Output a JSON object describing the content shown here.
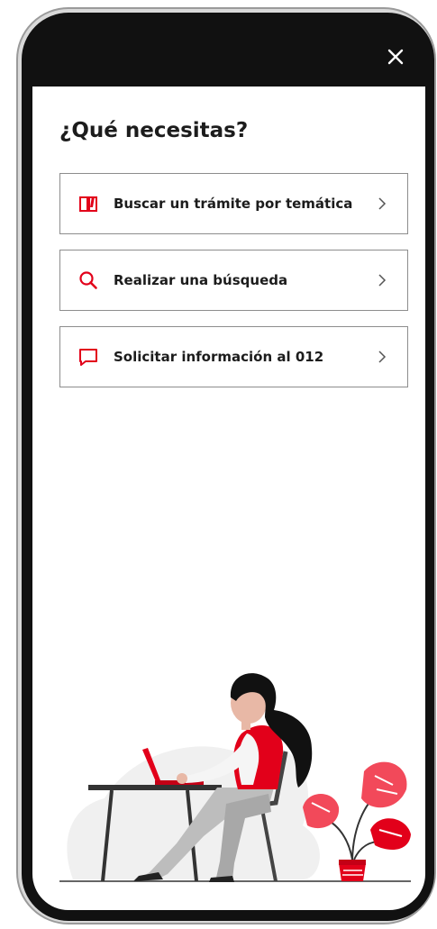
{
  "header": {
    "close_icon": "close-icon"
  },
  "main": {
    "title": "¿Qué necesitas?",
    "options": [
      {
        "label": "Buscar un trámite por temática",
        "icon": "book-icon"
      },
      {
        "label": "Realizar una búsqueda",
        "icon": "search-icon"
      },
      {
        "label": "Solicitar información al 012",
        "icon": "chat-icon"
      }
    ]
  },
  "colors": {
    "accent": "#e2001a",
    "text": "#1c1c1c",
    "border": "#8d8d8d",
    "topbar": "#111111"
  }
}
